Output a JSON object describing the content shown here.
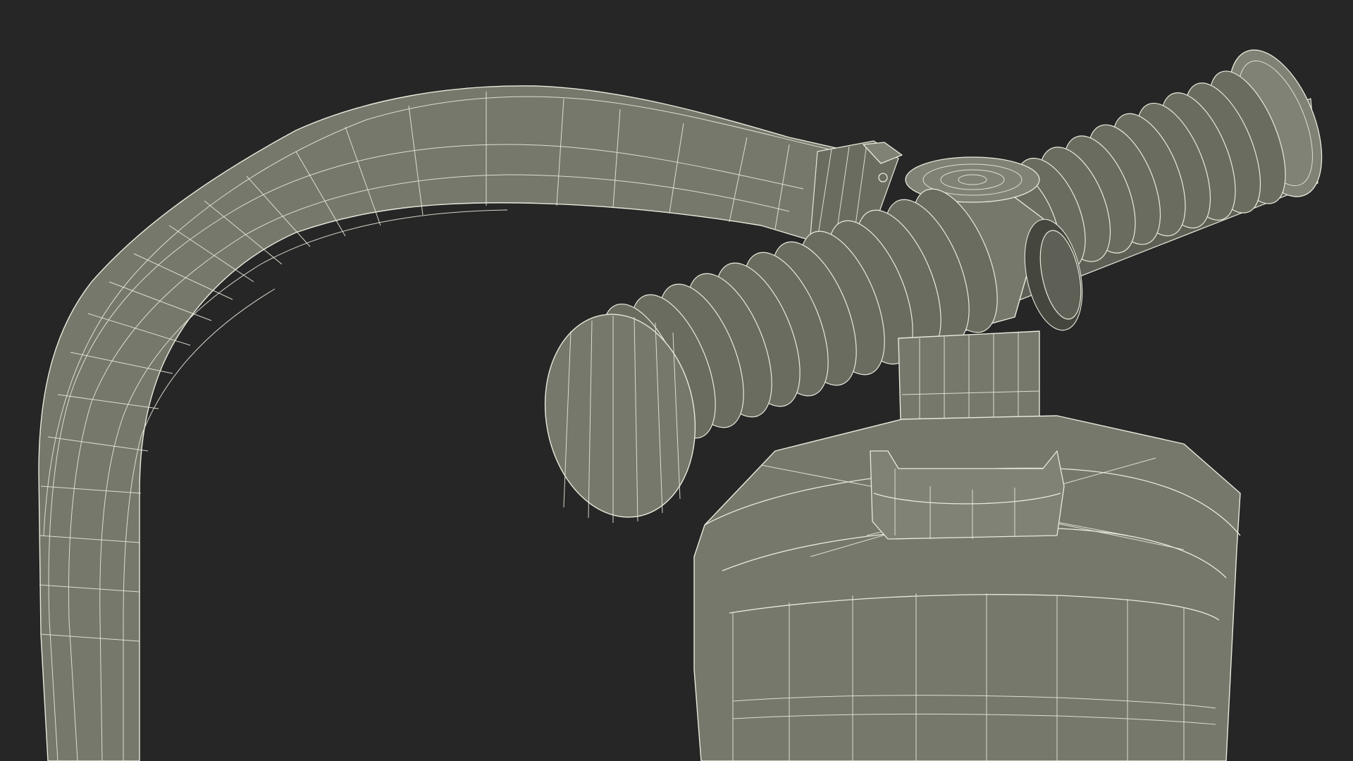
{
  "scene": {
    "background_color": "#262626",
    "mesh_fill_color": "#76786b",
    "mesh_shadow_color": "#5e6055",
    "wireframe_color": "#e9e9dd"
  }
}
